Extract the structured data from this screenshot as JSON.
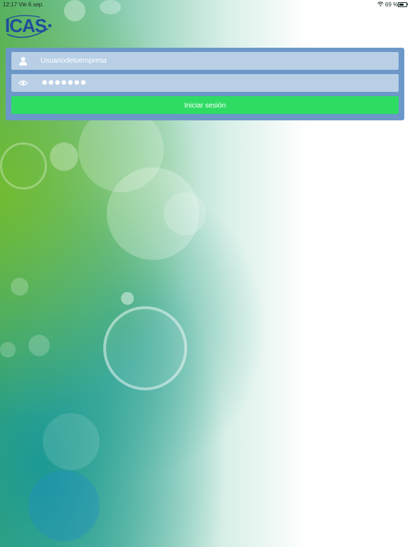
{
  "status_bar": {
    "time": "12:17",
    "date": "Vie 6 sep.",
    "battery": "69 %",
    "battery_level": 0.69
  },
  "logo": {
    "text": "ICAS"
  },
  "login": {
    "username_value": "Usuariodetuempresa",
    "password_mask": "●●●●●●●",
    "submit_label": "Iniciar sesión"
  },
  "colors": {
    "panel": "#6c98c9",
    "field": "#b8cfe6",
    "button": "#2edc64",
    "logo": "#1f4d9a"
  }
}
